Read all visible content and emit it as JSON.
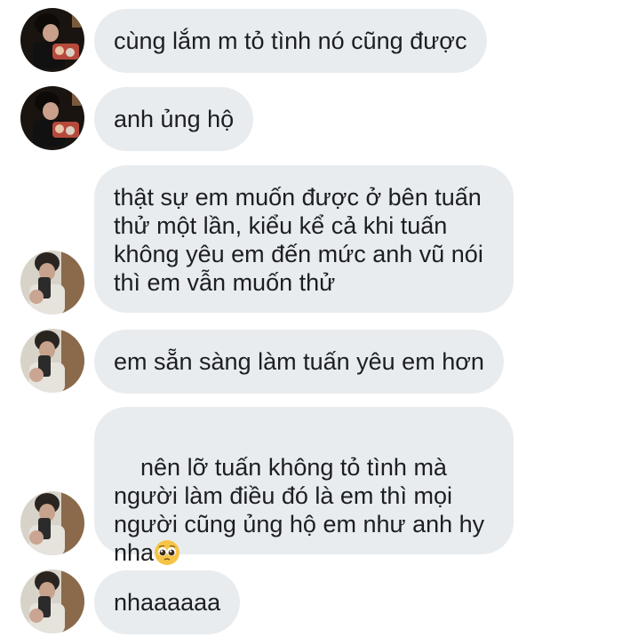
{
  "messages": [
    {
      "text": "cùng lắm m tỏ tình nó cũng được",
      "avatar": "dark-photo-avatar"
    },
    {
      "text": "anh ủng hộ",
      "avatar": "dark-photo-avatar"
    },
    {
      "text": "thật sự em muốn được ở bên tuấn thử một lần, kiểu kể cả khi tuấn không yêu em đến mức anh vũ nói thì em vẫn muốn thử",
      "avatar": "mirror-selfie-avatar"
    },
    {
      "text": "em sẵn sàng làm tuấn yêu em hơn",
      "avatar": "mirror-selfie-avatar"
    },
    {
      "text": "nên lỡ tuấn không tỏ tình mà người làm điều đó là em thì mọi người cũng ủng hộ em như anh hy nha",
      "avatar": "mirror-selfie-avatar",
      "emoji": "pleading-face-emoji"
    },
    {
      "text": "nhaaaaaa",
      "avatar": "mirror-selfie-avatar"
    }
  ],
  "colors": {
    "bubble_bg": "#e9ecef",
    "text": "#1c1e21",
    "background": "#ffffff"
  }
}
